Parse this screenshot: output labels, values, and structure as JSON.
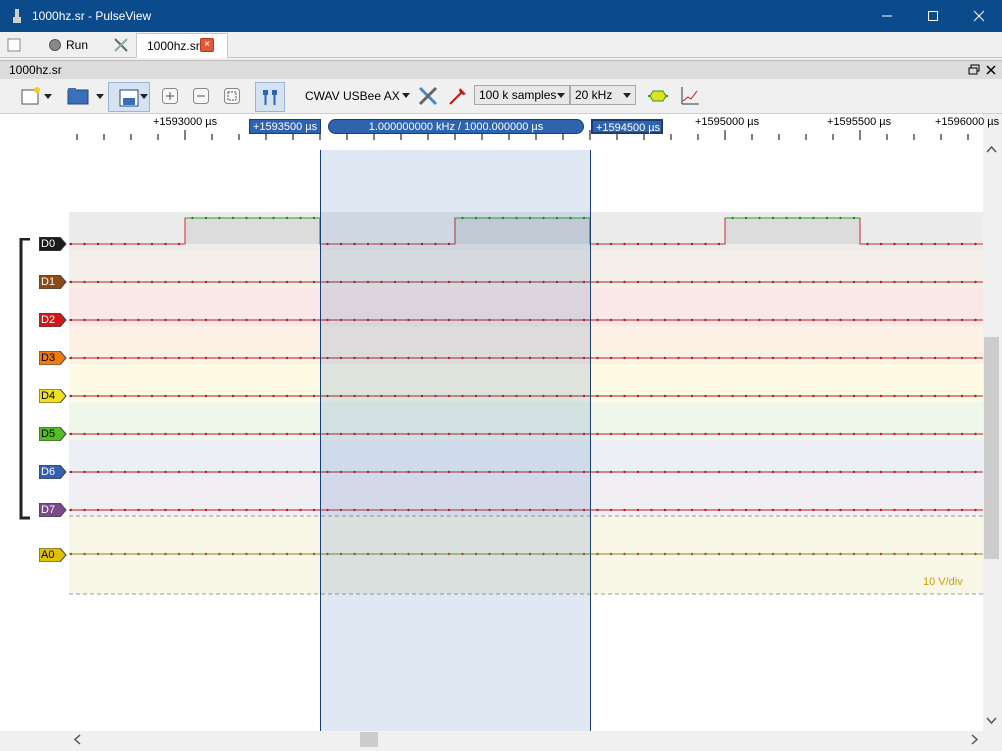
{
  "window": {
    "title": "1000hz.sr - PulseView"
  },
  "tabs": {
    "run_label": "Run",
    "document_tab": "1000hz.sr",
    "close_glyph": "×"
  },
  "subwindow": {
    "title": "1000hz.sr"
  },
  "toolbar": {
    "device": "CWAV USBee AX",
    "samples": "100 k samples",
    "rate": "20 kHz"
  },
  "ruler": {
    "ticks": [
      "+1593000 µs",
      "+1595000 µs",
      "+1595500 µs",
      "+1596000 µs"
    ],
    "cursor_left": "+1593500 µs",
    "cursor_right": "+1594500 µs",
    "cursor_measure": "1.000000000 kHz / 1000.000000 µs"
  },
  "channels": [
    {
      "name": "D0",
      "color": "#1a1a1a",
      "text": "#ffffff"
    },
    {
      "name": "D1",
      "color": "#8b4a14",
      "text": "#ffffff"
    },
    {
      "name": "D2",
      "color": "#d01818",
      "text": "#ffffff"
    },
    {
      "name": "D3",
      "color": "#f07a10",
      "text": "#000000"
    },
    {
      "name": "D4",
      "color": "#f0e020",
      "text": "#000000"
    },
    {
      "name": "D5",
      "color": "#50c020",
      "text": "#000000"
    },
    {
      "name": "D6",
      "color": "#3460b0",
      "text": "#ffffff"
    },
    {
      "name": "D7",
      "color": "#7a4a8a",
      "text": "#ffffff"
    },
    {
      "name": "A0",
      "color": "#e0c000",
      "text": "#000000"
    }
  ],
  "analog": {
    "scale": "10 V/div"
  }
}
